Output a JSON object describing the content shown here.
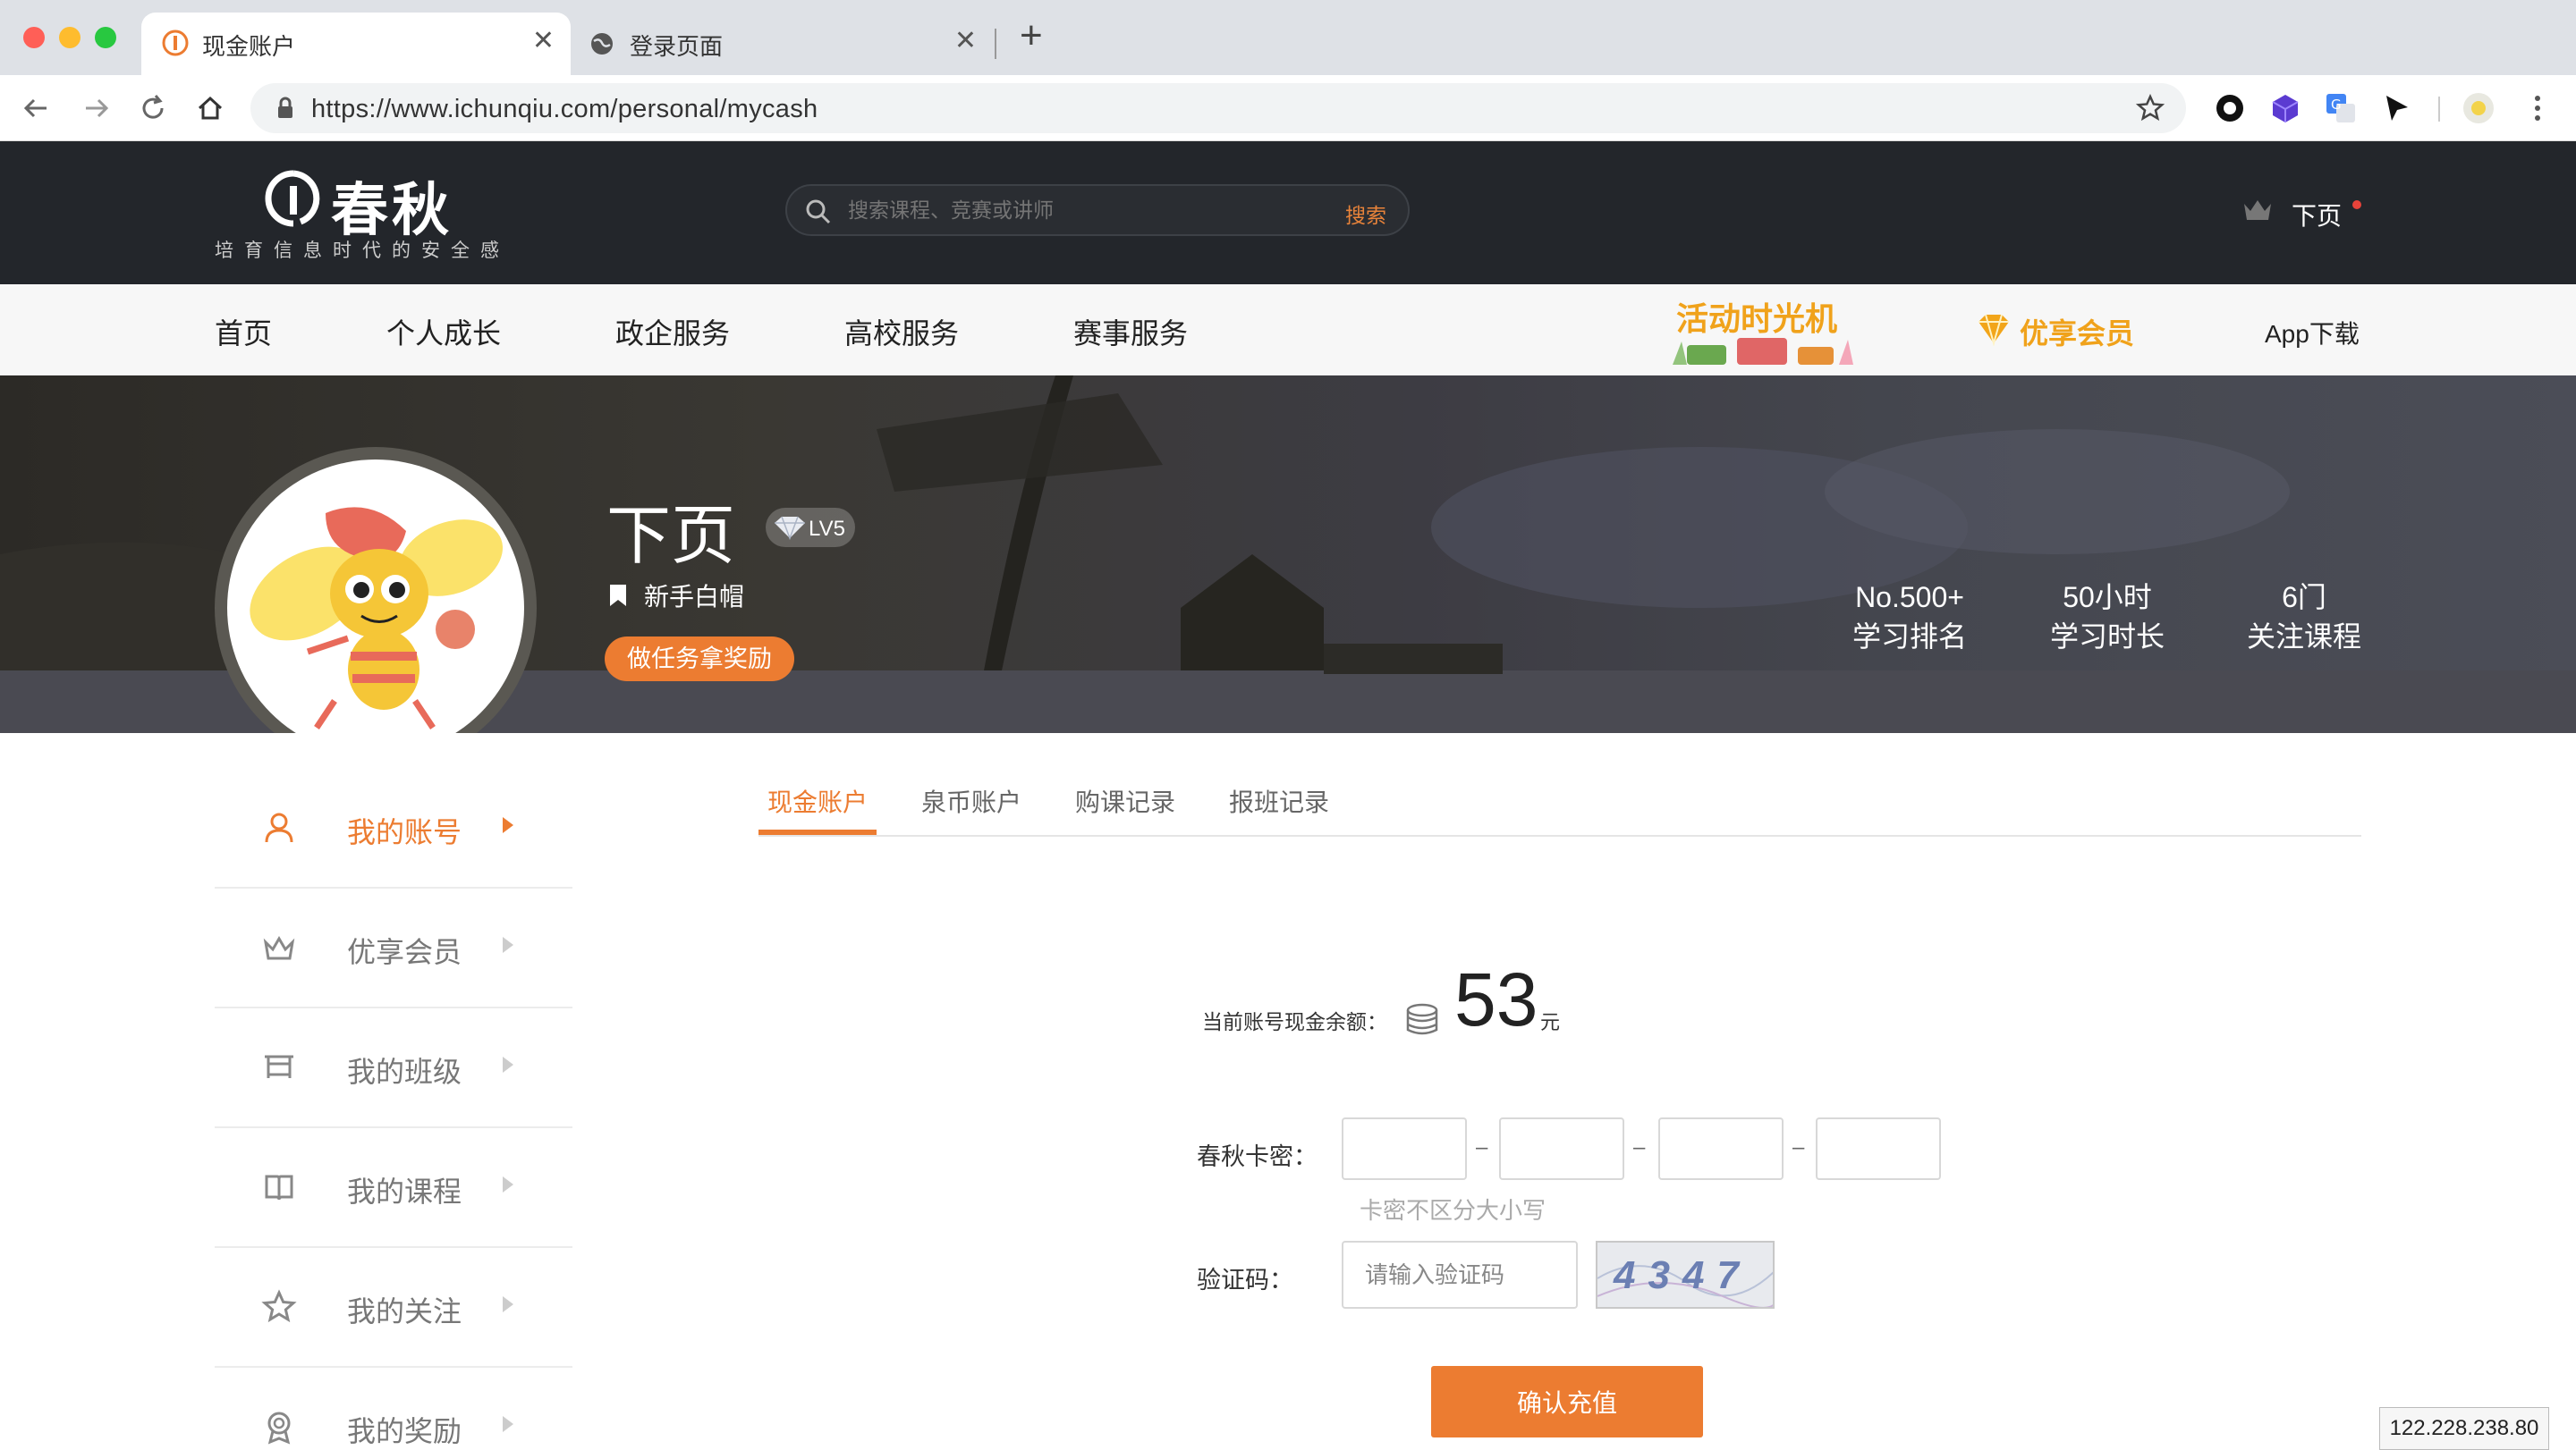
{
  "browser": {
    "tabs": [
      {
        "title": "现金账户",
        "icon": "ichunqiu-favicon-icon",
        "active": true
      },
      {
        "title": "登录页面",
        "icon": "globe-icon",
        "active": false
      }
    ],
    "close_glyph": "✕",
    "newtab_glyph": "+",
    "url": "https://www.ichunqiu.com/personal/mycash",
    "colors": {
      "tabbar": "#dee1e6",
      "close": "#ff5f57",
      "minimize": "#febc2e",
      "maximize": "#28c840"
    }
  },
  "header": {
    "logo_text": "春秋",
    "logo_tagline": "培育信息时代的安全感",
    "search_placeholder": "搜索课程、竞赛或讲师",
    "search_button": "搜索",
    "user_name": "下页"
  },
  "nav": {
    "items": [
      "首页",
      "个人成长",
      "政企服务",
      "高校服务",
      "赛事服务"
    ],
    "promo_label": "活动时光机",
    "vip_label": "优享会员",
    "app_label": "App下载"
  },
  "profile": {
    "name": "下页",
    "level": "LV5",
    "title": "新手白帽",
    "task_button": "做任务拿奖励",
    "stats": [
      {
        "value": "No.500+",
        "label": "学习排名"
      },
      {
        "value": "50小时",
        "label": "学习时长"
      },
      {
        "value": "6门",
        "label": "关注课程"
      }
    ]
  },
  "sidebar": {
    "items": [
      {
        "label": "我的账号",
        "icon": "user-icon",
        "active": true
      },
      {
        "label": "优享会员",
        "icon": "crown-icon",
        "active": false
      },
      {
        "label": "我的班级",
        "icon": "classroom-icon",
        "active": false
      },
      {
        "label": "我的课程",
        "icon": "book-icon",
        "active": false
      },
      {
        "label": "我的关注",
        "icon": "star-icon",
        "active": false
      },
      {
        "label": "我的奖励",
        "icon": "award-icon",
        "active": false
      }
    ]
  },
  "content": {
    "tabs": [
      "现金账户",
      "泉币账户",
      "购课记录",
      "报班记录"
    ],
    "balance_label": "当前账号现金余额：",
    "balance_value": "53",
    "balance_unit": "元",
    "card_label": "春秋卡密：",
    "card_dash": "–",
    "card_hint": "卡密不区分大小写",
    "captcha_label": "验证码：",
    "captcha_placeholder": "请输入验证码",
    "captcha_image_text": "4347",
    "submit_button": "确认充值"
  },
  "ip_address": "122.228.238.80",
  "accent_color": "#ec7c31"
}
